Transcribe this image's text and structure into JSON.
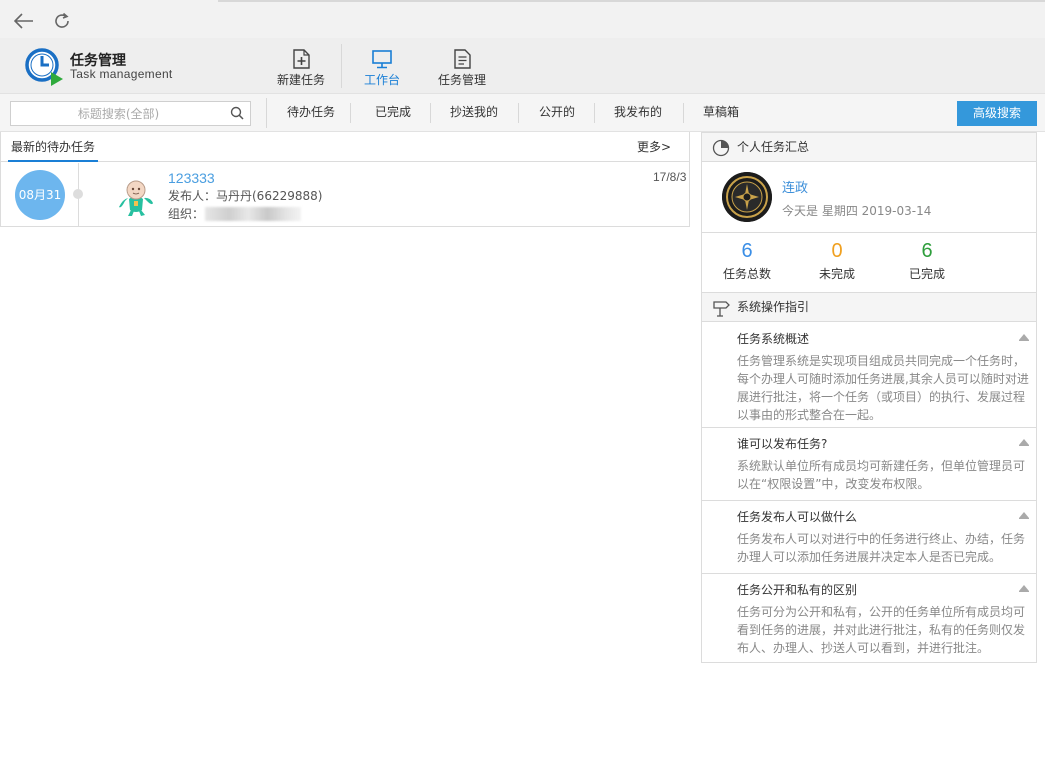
{
  "header": {
    "title": "任务管理",
    "subtitle": "Task management"
  },
  "nav": {
    "new_task": "新建任务",
    "workbench": "工作台",
    "task_manage": "任务管理"
  },
  "toolbar": {
    "search_placeholder": "标题搜索(全部)",
    "tabs": [
      "待办任务",
      "已完成",
      "抄送我的",
      "公开的",
      "我发布的",
      "草稿箱"
    ],
    "advanced_search": "高级搜索"
  },
  "left_panel": {
    "tab_label": "最新的待办任务",
    "more_label": "更多>",
    "tasks": [
      {
        "date_badge": "08月31",
        "title": "123333",
        "publisher": "发布人：马丹丹(66229888)",
        "org_label": "组织：",
        "date": "17/8/3"
      }
    ]
  },
  "summary": {
    "title": "个人任务汇总",
    "user_name": "连政",
    "today": "今天是 星期四  2019-03-14",
    "stats": [
      {
        "value": "6",
        "label": "任务总数",
        "color": "#3a8ee6"
      },
      {
        "value": "0",
        "label": "未完成",
        "color": "#f0a020"
      },
      {
        "value": "6",
        "label": "已完成",
        "color": "#2e9e3c"
      }
    ]
  },
  "guide": {
    "title": "系统操作指引",
    "items": [
      {
        "title": "任务系统概述",
        "body": "任务管理系统是实现项目组成员共同完成一个任务时，每个办理人可随时添加任务进展,其余人员可以随时对进展进行批注，将一个任务（或项目）的执行、发展过程以事由的形式整合在一起。"
      },
      {
        "title": "谁可以发布任务?",
        "body": "系统默认单位所有成员均可新建任务，但单位管理员可以在“权限设置”中，改变发布权限。"
      },
      {
        "title": "任务发布人可以做什么",
        "body": "任务发布人可以对进行中的任务进行终止、办结，任务办理人可以添加任务进展并决定本人是否已完成。"
      },
      {
        "title": "任务公开和私有的区别",
        "body": "任务可分为公开和私有，公开的任务单位所有成员均可看到任务的进展，并对此进行批注，私有的任务则仅发布人、办理人、抄送人可以看到，并进行批注。"
      }
    ]
  }
}
